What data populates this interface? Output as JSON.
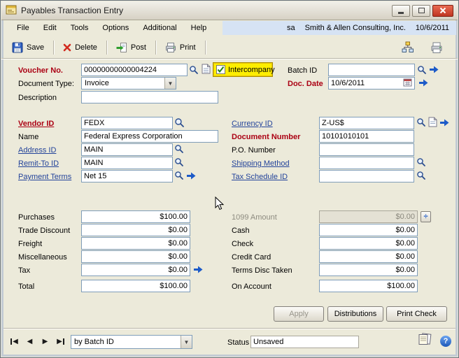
{
  "window": {
    "title": "Payables Transaction Entry"
  },
  "menubar": {
    "items": [
      "File",
      "Edit",
      "Tools",
      "Options",
      "Additional",
      "Help"
    ],
    "user": "sa",
    "company": "Smith & Allen Consulting, Inc.",
    "date": "10/6/2011"
  },
  "toolbar": {
    "save": "Save",
    "delete": "Delete",
    "post": "Post",
    "print": "Print"
  },
  "header": {
    "voucher": {
      "label": "Voucher No.",
      "value": "00000000000004224"
    },
    "intercompany": {
      "label": "Intercompany",
      "checked": true
    },
    "batch": {
      "label": "Batch ID",
      "value": ""
    },
    "doc_type": {
      "label": "Document Type:",
      "value": "Invoice"
    },
    "doc_date": {
      "label": "Doc. Date",
      "value": "10/6/2011"
    },
    "description": {
      "label": "Description",
      "value": ""
    }
  },
  "vendor": {
    "vendor_id": {
      "label": "Vendor ID",
      "value": "FEDX"
    },
    "name": {
      "label": "Name",
      "value": "Federal Express Corporation"
    },
    "address_id": {
      "label": "Address ID",
      "value": "MAIN"
    },
    "remit_to": {
      "label": "Remit-To ID",
      "value": "MAIN"
    },
    "payment_terms": {
      "label": "Payment Terms",
      "value": "Net 15"
    },
    "currency_id": {
      "label": "Currency ID",
      "value": "Z-US$"
    },
    "document_number": {
      "label": "Document Number",
      "value": "10101010101"
    },
    "po_number": {
      "label": "P.O. Number",
      "value": ""
    },
    "shipping_method": {
      "label": "Shipping Method",
      "value": ""
    },
    "tax_schedule_id": {
      "label": "Tax Schedule ID",
      "value": ""
    }
  },
  "amounts_left": [
    {
      "label": "Purchases",
      "value": "$100.00"
    },
    {
      "label": "Trade Discount",
      "value": "$0.00"
    },
    {
      "label": "Freight",
      "value": "$0.00"
    },
    {
      "label": "Miscellaneous",
      "value": "$0.00"
    },
    {
      "label": "Tax",
      "value": "$0.00"
    },
    {
      "label": "Total",
      "value": "$100.00"
    }
  ],
  "amounts_right": [
    {
      "label": "1099 Amount",
      "value": "$0.00"
    },
    {
      "label": "Cash",
      "value": "$0.00"
    },
    {
      "label": "Check",
      "value": "$0.00"
    },
    {
      "label": "Credit Card",
      "value": "$0.00"
    },
    {
      "label": "Terms Disc Taken",
      "value": "$0.00"
    },
    {
      "label": "On Account",
      "value": "$100.00"
    }
  ],
  "actions": {
    "apply": "Apply",
    "distributions": "Distributions",
    "print_check": "Print Check"
  },
  "footer": {
    "browse_by": "by Batch ID",
    "status_label": "Status",
    "status_value": "Unsaved"
  }
}
